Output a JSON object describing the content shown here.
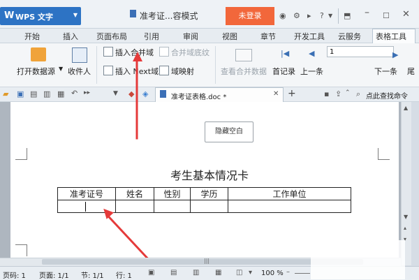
{
  "title_bar": {
    "app_logo": "W",
    "app_name": "WPS 文字",
    "document_title": "准考证...容模式",
    "login_button": "未登录"
  },
  "menu_tabs": [
    "开始",
    "插入",
    "页面布局",
    "引用",
    "审阅",
    "视图",
    "章节",
    "开发工具",
    "云服务",
    "表格工具"
  ],
  "active_tab": "表格工具",
  "ribbon": {
    "open_datasource": "打开数据源",
    "recipients": "收件人",
    "insert_merge_field": "插入合并域",
    "merge_field_shading": "合并域底纹",
    "insert_next_field": "插入 Next域",
    "field_mapping": "域映射",
    "view_merged_data": "查看合并数据",
    "first_record": "首记录",
    "prev_record": "上一条",
    "next_record": "下一条",
    "last_record_partial": "尾",
    "record_value": "1"
  },
  "quick_bar": {
    "doc_tab_name": "准考证表格.doc *",
    "search_hint": "点此查找命令"
  },
  "document": {
    "hide_blank_button": "隐藏空白",
    "card_title": "考生基本情况卡",
    "table_headers": [
      "准考证号",
      "姓名",
      "性别",
      "学历",
      "工作单位"
    ]
  },
  "status_bar": {
    "page_label": "页码: 1",
    "pages_label": "页面: 1/1",
    "section_label": "节: 1/1",
    "row_label": "行: 1",
    "zoom": "100 %"
  },
  "colors": {
    "app_blue": "#2d73c4",
    "login_orange": "#f2673b",
    "annotation_red": "#e53a3a"
  }
}
